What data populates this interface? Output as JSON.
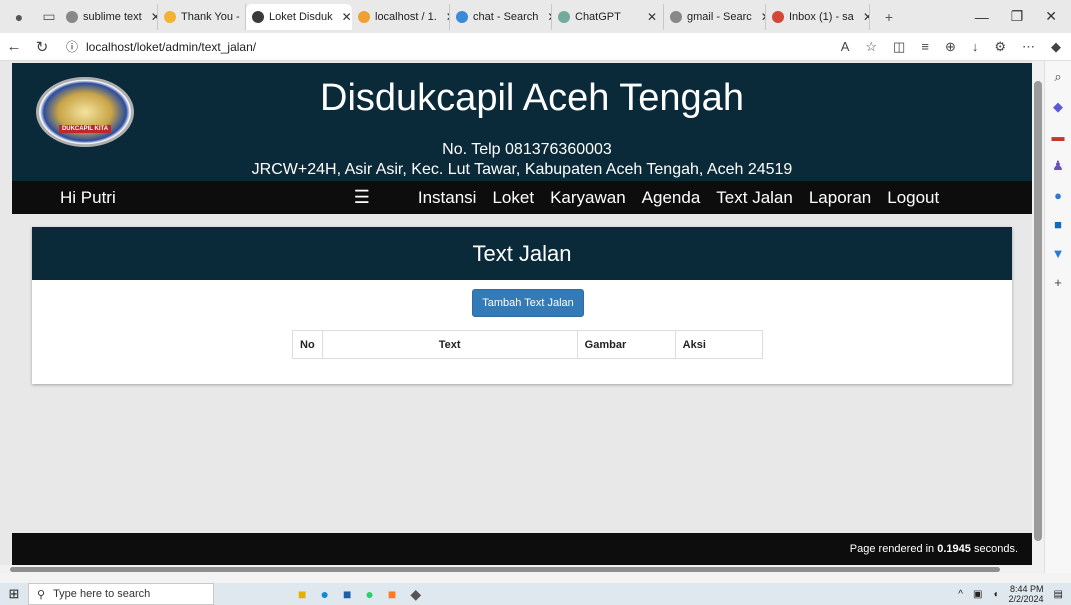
{
  "browser": {
    "tabs": [
      {
        "label": "sublime text",
        "color": "#888888"
      },
      {
        "label": "Thank You -",
        "color": "#f2b233"
      },
      {
        "label": "Loket Disduk",
        "color": "#3a3a3a",
        "active": true
      },
      {
        "label": "localhost / 1.",
        "color": "#f0a030"
      },
      {
        "label": "chat - Search",
        "color": "#3b8ad9"
      },
      {
        "label": "ChatGPT",
        "color": "#74aa9c"
      },
      {
        "label": "gmail - Searc",
        "color": "#888888"
      },
      {
        "label": "Inbox (1) - sa",
        "color": "#d44638"
      }
    ],
    "url": "localhost/loket/admin/text_jalan/"
  },
  "header": {
    "logo_text": "DUKCAPIL KITA",
    "title": "Disdukcapil Aceh Tengah",
    "telp": "No. Telp 081376360003",
    "alamat": "JRCW+24H, Asir Asir, Kec. Lut Tawar, Kabupaten Aceh Tengah, Aceh 24519"
  },
  "navbar": {
    "greeting": "Hi Putri",
    "links": [
      "Instansi",
      "Loket",
      "Karyawan",
      "Agenda",
      "Text Jalan",
      "Laporan",
      "Logout"
    ]
  },
  "panel": {
    "title": "Text Jalan",
    "add_button": "Tambah Text Jalan",
    "columns": [
      "No",
      "Text",
      "Gambar",
      "Aksi"
    ]
  },
  "footer": {
    "text_prefix": "Page rendered in ",
    "seconds": "0.1945",
    "text_suffix": " seconds."
  },
  "taskbar": {
    "search_placeholder": "Type here to search",
    "time": "8:44 PM",
    "date": "2/2/2024"
  }
}
